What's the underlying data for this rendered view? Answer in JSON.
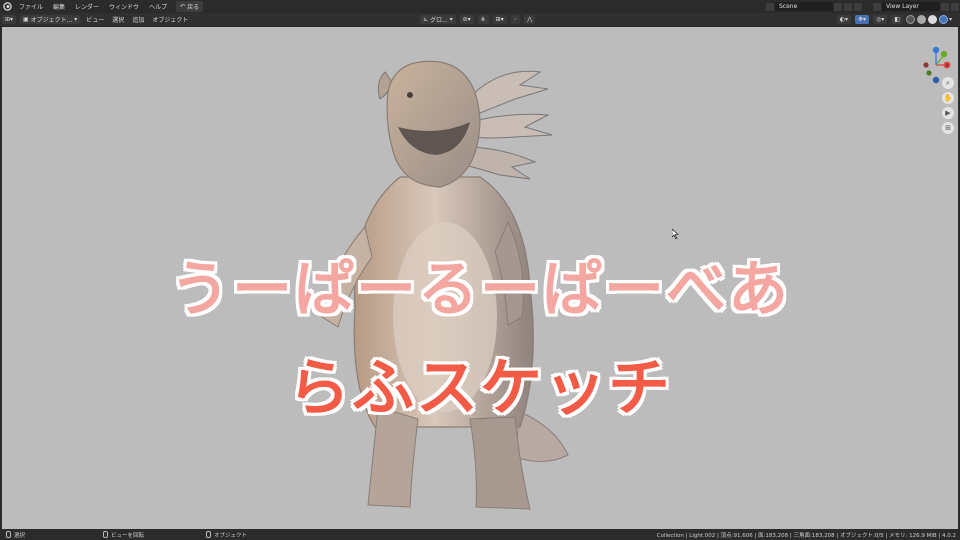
{
  "topbar": {
    "menus": [
      "ファイル",
      "編集",
      "レンダー",
      "ウィンドウ",
      "ヘルプ"
    ],
    "undo_label": "戻る",
    "scene_name": "Scene",
    "view_layer": "View Layer"
  },
  "header": {
    "mode": "オブジェクト...",
    "menus": [
      "ビュー",
      "選択",
      "追加",
      "オブジェクト"
    ],
    "transform_orientation": "グロ..."
  },
  "viewport": {
    "title_line1": "うーぱーるーぱーべあ",
    "title_line2": "らふスケッチ",
    "gizmo_axes": {
      "x": "X",
      "y": "Y",
      "z": "Z"
    },
    "background_color": "#bcbcbc"
  },
  "statusbar": {
    "left_select": "選択",
    "middle_action": "ビューを回転",
    "right_action": "オブジェクト",
    "stats": "Collection | Light.002 | 頂点:91,606 | 面:183,208 | 三角面:183,208 | オブジェクト:0/5 | メモリ: 126.9 MiB | 4.0.2"
  },
  "colors": {
    "title_line1": "#f4a6a0",
    "title_line2": "#f25b45",
    "axis_x": "#e0433a",
    "axis_y": "#6aa82d",
    "axis_z": "#3b78d8"
  }
}
